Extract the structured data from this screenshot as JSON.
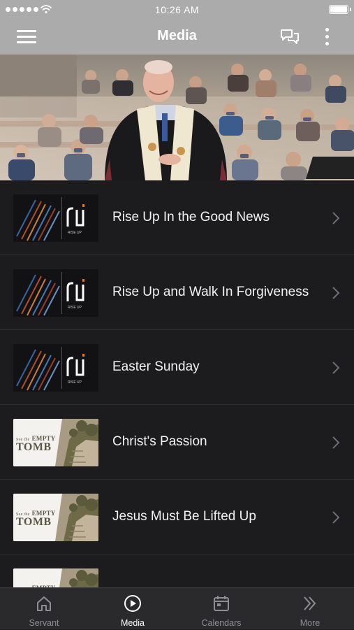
{
  "status_bar": {
    "time": "10:26 AM"
  },
  "header": {
    "title": "Media",
    "menu_icon": "hamburger-menu-icon",
    "chat_icon": "chat-bubbles-icon",
    "more_icon": "vertical-dots-icon"
  },
  "hero": {
    "description": "Pastor in clerical robe and stole standing before masked congregation"
  },
  "media_list": [
    {
      "title": "Rise Up In the Good News",
      "thumb": "rise-up"
    },
    {
      "title": "Rise Up and Walk In Forgiveness",
      "thumb": "rise-up"
    },
    {
      "title": "Easter Sunday",
      "thumb": "rise-up"
    },
    {
      "title": "Christ's Passion",
      "thumb": "empty-tomb"
    },
    {
      "title": "Jesus Must Be Lifted Up",
      "thumb": "empty-tomb"
    },
    {
      "title": "",
      "thumb": "empty-tomb"
    }
  ],
  "thumb_text": {
    "rise_up_caption": "RISE UP",
    "tomb_prefix": "See the",
    "tomb_line1": "EMPTY",
    "tomb_line2": "TOMB"
  },
  "tab_bar": [
    {
      "label": "Servant",
      "icon": "home-icon",
      "active": false
    },
    {
      "label": "Media",
      "icon": "play-circle-icon",
      "active": true
    },
    {
      "label": "Calendars",
      "icon": "calendar-icon",
      "active": false
    },
    {
      "label": "More",
      "icon": "double-chevron-right-icon",
      "active": false
    }
  ],
  "colors": {
    "header_bg": "#ababab",
    "list_bg": "#1c1c1e",
    "tabbar_bg": "#2a2a2c",
    "tab_inactive": "#8e8e93",
    "tab_active": "#ffffff"
  }
}
